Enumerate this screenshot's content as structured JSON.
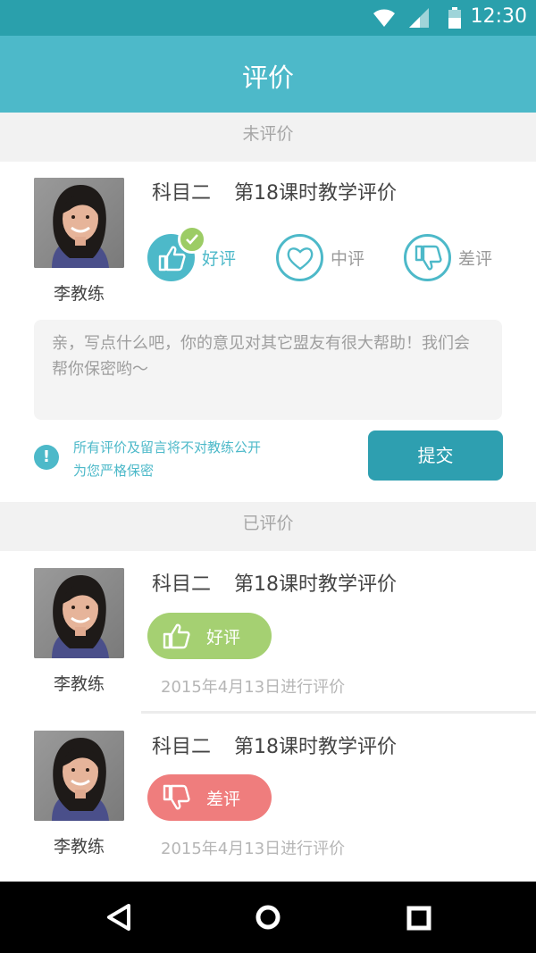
{
  "status_bar": {
    "time": "12:30",
    "icons": [
      "wifi-icon",
      "signal-icon",
      "battery-icon"
    ]
  },
  "app_bar": {
    "title": "评价"
  },
  "pending": {
    "header": "未评价",
    "item": {
      "coach_name": "李教练",
      "subject": "科目二",
      "lesson": "第18课时教学评价",
      "options": [
        {
          "label": "好评",
          "icon": "thumbs-up-icon",
          "selected": true
        },
        {
          "label": "中评",
          "icon": "heart-icon",
          "selected": false
        },
        {
          "label": "差评",
          "icon": "thumbs-down-icon",
          "selected": false
        }
      ],
      "comment_placeholder": "亲，写点什么吧，你的意见对其它盟友有很大帮助！我们会帮你保密哟～",
      "notice_line1": "所有评价及留言将不对教练公开",
      "notice_line2": "为您严格保密",
      "submit_label": "提交"
    }
  },
  "done": {
    "header": "已评价",
    "items": [
      {
        "coach_name": "李教练",
        "subject": "科目二",
        "lesson": "第18课时教学评价",
        "rating": "好评",
        "date": "2015年4月13日进行评价"
      },
      {
        "coach_name": "李教练",
        "subject": "科目二",
        "lesson": "第18课时教学评价",
        "rating": "差评",
        "date": "2015年4月13日进行评价"
      }
    ]
  },
  "colors": {
    "primary": "#4db9c9",
    "status_bar": "#2aa0ac",
    "good": "#a5d072",
    "bad": "#ef7d7d",
    "submit": "#2e9fb0"
  },
  "nav_bar": {
    "icons": [
      "back-icon",
      "home-icon",
      "recents-icon"
    ]
  }
}
